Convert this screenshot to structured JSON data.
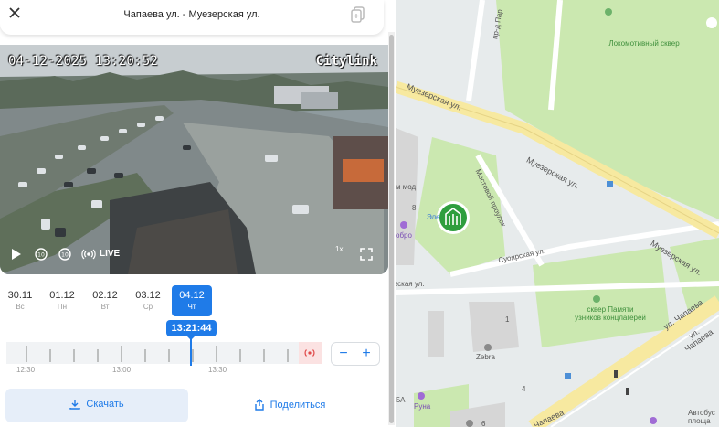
{
  "header": {
    "title": "Чапаева ул. - Муезерская ул."
  },
  "video": {
    "timestamp": "04-12-2025 13:20:52",
    "brand": "Citylink",
    "live_label": "LIVE",
    "speed_label": "1x"
  },
  "days": [
    {
      "date": "30.11",
      "weekday": "Вс"
    },
    {
      "date": "01.12",
      "weekday": "Пн"
    },
    {
      "date": "02.12",
      "weekday": "Вт"
    },
    {
      "date": "03.12",
      "weekday": "Ср"
    },
    {
      "date": "04.12",
      "weekday": "Чт",
      "active": true
    }
  ],
  "timeline": {
    "current_time": "13:21:44",
    "labels": [
      "12:30",
      "13:00",
      "13:30"
    ],
    "zoom_out": "−",
    "zoom_in": "+"
  },
  "actions": {
    "download": "Скачать",
    "share": "Поделиться"
  },
  "map": {
    "labels": {
      "park_lokomotiv": "Локомотивный сквер",
      "muezerskaya_1": "Муезерская ул.",
      "muezerskaya_2": "Муезерская ул.",
      "muezerskaya_3": "Муезерская ул.",
      "mostovoy": "Мостовой проулок",
      "suoyarskaya": "Суоярская ул.",
      "vskaya": "вская ул.",
      "park_memory": "сквер Памяти узников концлагерей",
      "chapaeva_1": "ул. Чапаева",
      "chapaeva_2": "ул. Чапаева",
      "chapaeva_3": "Чапаева",
      "pr_par": "пр-д Пар",
      "zebra": "Zebra",
      "runa": "Руна",
      "dobro": "обро",
      "mmod": "м мод",
      "ele": "Эле",
      "ba": "БА",
      "bus": "Автобус площа",
      "num_8": "8",
      "num_1": "1",
      "num_4": "4",
      "num_6": "6"
    },
    "colors": {
      "park": "#cbe8b0",
      "road_main": "#f7e9a0",
      "building": "#d6d6d6",
      "marker": "#2e9e3e"
    }
  }
}
